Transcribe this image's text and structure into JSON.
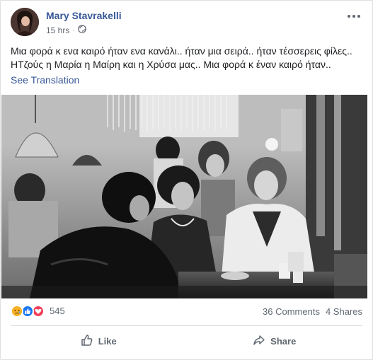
{
  "post": {
    "author": "Mary Stavrakelli",
    "time": "15 hrs",
    "privacy_icon": "globe-icon",
    "text": "Μια φορά κ ενα καιρό ήταν ενα κανάλι.. ήταν μια σειρά.. ήταν τέσσερεις φίλες.. ΗΤζούς η Μαρία η Μαίρη και η Χρύσα μας.. Μια φορά κ έναν καιρό ήταν..",
    "see_translation": "See Translation"
  },
  "stats": {
    "reactions": [
      "sad",
      "like",
      "love"
    ],
    "reaction_count": "545",
    "comments": "36 Comments",
    "shares": "4 Shares"
  },
  "actions": {
    "like": "Like",
    "share": "Share"
  },
  "colors": {
    "link": "#385898",
    "like_blue": "#1877f2",
    "love_red": "#f33e58",
    "sad_yellow": "#f7b125"
  }
}
